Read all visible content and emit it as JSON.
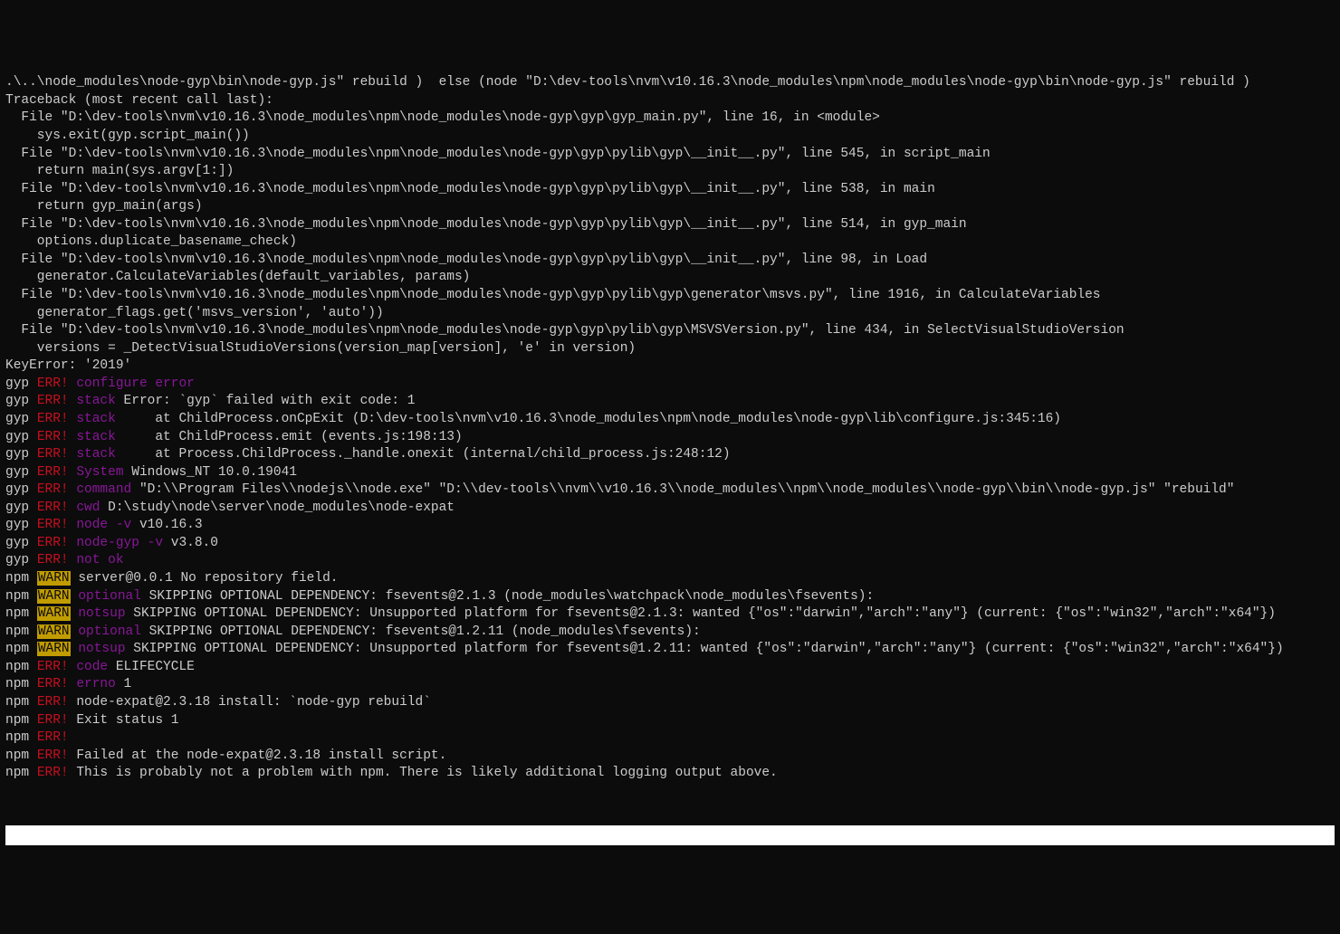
{
  "lines": [
    {
      "segments": [
        {
          "cls": "white",
          "text": ".\\..\\node_modules\\node-gyp\\bin\\node-gyp.js\" rebuild )  else (node \"D:\\dev-tools\\nvm\\v10.16.3\\node_modules\\npm\\node_modules\\node-gyp\\bin\\node-gyp.js\" rebuild )"
        }
      ]
    },
    {
      "segments": [
        {
          "cls": "white",
          "text": "Traceback (most recent call last):"
        }
      ]
    },
    {
      "segments": [
        {
          "cls": "white",
          "text": "  File \"D:\\dev-tools\\nvm\\v10.16.3\\node_modules\\npm\\node_modules\\node-gyp\\gyp\\gyp_main.py\", line 16, in <module>"
        }
      ]
    },
    {
      "segments": [
        {
          "cls": "white",
          "text": "    sys.exit(gyp.script_main())"
        }
      ]
    },
    {
      "segments": [
        {
          "cls": "white",
          "text": "  File \"D:\\dev-tools\\nvm\\v10.16.3\\node_modules\\npm\\node_modules\\node-gyp\\gyp\\pylib\\gyp\\__init__.py\", line 545, in script_main"
        }
      ]
    },
    {
      "segments": [
        {
          "cls": "white",
          "text": "    return main(sys.argv[1:])"
        }
      ]
    },
    {
      "segments": [
        {
          "cls": "white",
          "text": "  File \"D:\\dev-tools\\nvm\\v10.16.3\\node_modules\\npm\\node_modules\\node-gyp\\gyp\\pylib\\gyp\\__init__.py\", line 538, in main"
        }
      ]
    },
    {
      "segments": [
        {
          "cls": "white",
          "text": "    return gyp_main(args)"
        }
      ]
    },
    {
      "segments": [
        {
          "cls": "white",
          "text": "  File \"D:\\dev-tools\\nvm\\v10.16.3\\node_modules\\npm\\node_modules\\node-gyp\\gyp\\pylib\\gyp\\__init__.py\", line 514, in gyp_main"
        }
      ]
    },
    {
      "segments": [
        {
          "cls": "white",
          "text": "    options.duplicate_basename_check)"
        }
      ]
    },
    {
      "segments": [
        {
          "cls": "white",
          "text": "  File \"D:\\dev-tools\\nvm\\v10.16.3\\node_modules\\npm\\node_modules\\node-gyp\\gyp\\pylib\\gyp\\__init__.py\", line 98, in Load"
        }
      ]
    },
    {
      "segments": [
        {
          "cls": "white",
          "text": "    generator.CalculateVariables(default_variables, params)"
        }
      ]
    },
    {
      "segments": [
        {
          "cls": "white",
          "text": "  File \"D:\\dev-tools\\nvm\\v10.16.3\\node_modules\\npm\\node_modules\\node-gyp\\gyp\\pylib\\gyp\\generator\\msvs.py\", line 1916, in CalculateVariables"
        }
      ]
    },
    {
      "segments": [
        {
          "cls": "white",
          "text": "    generator_flags.get('msvs_version', 'auto'))"
        }
      ]
    },
    {
      "segments": [
        {
          "cls": "white",
          "text": "  File \"D:\\dev-tools\\nvm\\v10.16.3\\node_modules\\npm\\node_modules\\node-gyp\\gyp\\pylib\\gyp\\MSVSVersion.py\", line 434, in SelectVisualStudioVersion"
        }
      ]
    },
    {
      "segments": [
        {
          "cls": "white",
          "text": "    versions = _DetectVisualStudioVersions(version_map[version], 'e' in version)"
        }
      ]
    },
    {
      "segments": [
        {
          "cls": "white",
          "text": "KeyError: '2019'"
        }
      ]
    },
    {
      "segments": [
        {
          "cls": "white",
          "text": "gyp "
        },
        {
          "cls": "red",
          "text": "ERR! "
        },
        {
          "cls": "magenta",
          "text": "configure error"
        }
      ]
    },
    {
      "segments": [
        {
          "cls": "white",
          "text": "gyp "
        },
        {
          "cls": "red",
          "text": "ERR! "
        },
        {
          "cls": "magenta",
          "text": "stack"
        },
        {
          "cls": "white",
          "text": " Error: `gyp` failed with exit code: 1"
        }
      ]
    },
    {
      "segments": [
        {
          "cls": "white",
          "text": "gyp "
        },
        {
          "cls": "red",
          "text": "ERR! "
        },
        {
          "cls": "magenta",
          "text": "stack"
        },
        {
          "cls": "white",
          "text": "     at ChildProcess.onCpExit (D:\\dev-tools\\nvm\\v10.16.3\\node_modules\\npm\\node_modules\\node-gyp\\lib\\configure.js:345:16)"
        }
      ]
    },
    {
      "segments": [
        {
          "cls": "white",
          "text": "gyp "
        },
        {
          "cls": "red",
          "text": "ERR! "
        },
        {
          "cls": "magenta",
          "text": "stack"
        },
        {
          "cls": "white",
          "text": "     at ChildProcess.emit (events.js:198:13)"
        }
      ]
    },
    {
      "segments": [
        {
          "cls": "white",
          "text": "gyp "
        },
        {
          "cls": "red",
          "text": "ERR! "
        },
        {
          "cls": "magenta",
          "text": "stack"
        },
        {
          "cls": "white",
          "text": "     at Process.ChildProcess._handle.onexit (internal/child_process.js:248:12)"
        }
      ]
    },
    {
      "segments": [
        {
          "cls": "white",
          "text": "gyp "
        },
        {
          "cls": "red",
          "text": "ERR! "
        },
        {
          "cls": "magenta",
          "text": "System"
        },
        {
          "cls": "white",
          "text": " Windows_NT 10.0.19041"
        }
      ]
    },
    {
      "segments": [
        {
          "cls": "white",
          "text": "gyp "
        },
        {
          "cls": "red",
          "text": "ERR! "
        },
        {
          "cls": "magenta",
          "text": "command"
        },
        {
          "cls": "white",
          "text": " \"D:\\\\Program Files\\\\nodejs\\\\node.exe\" \"D:\\\\dev-tools\\\\nvm\\\\v10.16.3\\\\node_modules\\\\npm\\\\node_modules\\\\node-gyp\\\\bin\\\\node-gyp.js\" \"rebuild\""
        }
      ]
    },
    {
      "segments": [
        {
          "cls": "white",
          "text": "gyp "
        },
        {
          "cls": "red",
          "text": "ERR! "
        },
        {
          "cls": "magenta",
          "text": "cwd"
        },
        {
          "cls": "white",
          "text": " D:\\study\\node\\server\\node_modules\\node-expat"
        }
      ]
    },
    {
      "segments": [
        {
          "cls": "white",
          "text": "gyp "
        },
        {
          "cls": "red",
          "text": "ERR! "
        },
        {
          "cls": "magenta",
          "text": "node -v"
        },
        {
          "cls": "white",
          "text": " v10.16.3"
        }
      ]
    },
    {
      "segments": [
        {
          "cls": "white",
          "text": "gyp "
        },
        {
          "cls": "red",
          "text": "ERR! "
        },
        {
          "cls": "magenta",
          "text": "node-gyp -v"
        },
        {
          "cls": "white",
          "text": " v3.8.0"
        }
      ]
    },
    {
      "segments": [
        {
          "cls": "white",
          "text": "gyp "
        },
        {
          "cls": "red",
          "text": "ERR! "
        },
        {
          "cls": "magenta",
          "text": "not ok"
        }
      ]
    },
    {
      "segments": [
        {
          "cls": "white",
          "text": "npm "
        },
        {
          "cls": "warn-bg",
          "text": "WARN"
        },
        {
          "cls": "white",
          "text": " server@0.0.1 No repository field."
        }
      ]
    },
    {
      "segments": [
        {
          "cls": "white",
          "text": "npm "
        },
        {
          "cls": "warn-bg",
          "text": "WARN"
        },
        {
          "cls": "white",
          "text": " "
        },
        {
          "cls": "magenta",
          "text": "optional"
        },
        {
          "cls": "white",
          "text": " SKIPPING OPTIONAL DEPENDENCY: fsevents@2.1.3 (node_modules\\watchpack\\node_modules\\fsevents):"
        }
      ]
    },
    {
      "segments": [
        {
          "cls": "white",
          "text": "npm "
        },
        {
          "cls": "warn-bg",
          "text": "WARN"
        },
        {
          "cls": "white",
          "text": " "
        },
        {
          "cls": "magenta",
          "text": "notsup"
        },
        {
          "cls": "white",
          "text": " SKIPPING OPTIONAL DEPENDENCY: Unsupported platform for fsevents@2.1.3: wanted {\"os\":\"darwin\",\"arch\":\"any\"} (current: {\"os\":\"win32\",\"arch\":\"x64\"})"
        }
      ]
    },
    {
      "segments": [
        {
          "cls": "white",
          "text": "npm "
        },
        {
          "cls": "warn-bg",
          "text": "WARN"
        },
        {
          "cls": "white",
          "text": " "
        },
        {
          "cls": "magenta",
          "text": "optional"
        },
        {
          "cls": "white",
          "text": " SKIPPING OPTIONAL DEPENDENCY: fsevents@1.2.11 (node_modules\\fsevents):"
        }
      ]
    },
    {
      "segments": [
        {
          "cls": "white",
          "text": "npm "
        },
        {
          "cls": "warn-bg",
          "text": "WARN"
        },
        {
          "cls": "white",
          "text": " "
        },
        {
          "cls": "magenta",
          "text": "notsup"
        },
        {
          "cls": "white",
          "text": " SKIPPING OPTIONAL DEPENDENCY: Unsupported platform for fsevents@1.2.11: wanted {\"os\":\"darwin\",\"arch\":\"any\"} (current: {\"os\":\"win32\",\"arch\":\"x64\"})"
        }
      ]
    },
    {
      "segments": [
        {
          "cls": "white",
          "text": ""
        }
      ]
    },
    {
      "segments": [
        {
          "cls": "white",
          "text": "npm "
        },
        {
          "cls": "red",
          "text": "ERR!"
        },
        {
          "cls": "white",
          "text": " "
        },
        {
          "cls": "magenta",
          "text": "code"
        },
        {
          "cls": "white",
          "text": " ELIFECYCLE"
        }
      ]
    },
    {
      "segments": [
        {
          "cls": "white",
          "text": "npm "
        },
        {
          "cls": "red",
          "text": "ERR!"
        },
        {
          "cls": "white",
          "text": " "
        },
        {
          "cls": "magenta",
          "text": "errno"
        },
        {
          "cls": "white",
          "text": " 1"
        }
      ]
    },
    {
      "segments": [
        {
          "cls": "white",
          "text": "npm "
        },
        {
          "cls": "red",
          "text": "ERR!"
        },
        {
          "cls": "white",
          "text": " node-expat@2.3.18 install: `node-gyp rebuild`"
        }
      ]
    },
    {
      "segments": [
        {
          "cls": "white",
          "text": "npm "
        },
        {
          "cls": "red",
          "text": "ERR!"
        },
        {
          "cls": "white",
          "text": " Exit status 1"
        }
      ]
    },
    {
      "segments": [
        {
          "cls": "white",
          "text": "npm "
        },
        {
          "cls": "red",
          "text": "ERR!"
        }
      ]
    },
    {
      "segments": [
        {
          "cls": "white",
          "text": "npm "
        },
        {
          "cls": "red",
          "text": "ERR!"
        },
        {
          "cls": "white",
          "text": " Failed at the node-expat@2.3.18 install script."
        }
      ]
    },
    {
      "segments": [
        {
          "cls": "white",
          "text": "npm "
        },
        {
          "cls": "red",
          "text": "ERR!"
        },
        {
          "cls": "white",
          "text": " This is probably not a problem with npm. There is likely additional logging output above."
        }
      ]
    }
  ]
}
